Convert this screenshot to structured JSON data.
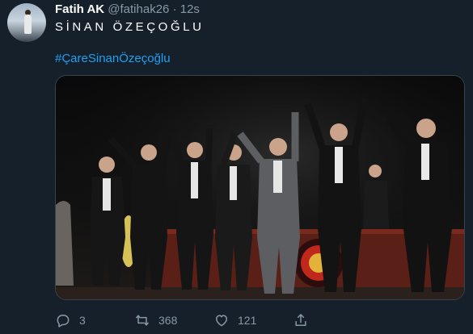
{
  "tweet": {
    "author_name": "Fatih AK",
    "author_handle": "@fatihak26",
    "separator": "·",
    "timestamp": "12s",
    "text": "SİNAN ÖZEÇOĞLU",
    "hashtag": "#ÇareSinanÖzeçoğlu"
  },
  "actions": {
    "reply_count": "3",
    "retweet_count": "368",
    "like_count": "121"
  },
  "icons": {
    "reply": "reply-icon",
    "retweet": "retweet-icon",
    "like": "like-icon",
    "share": "share-icon"
  },
  "colors": {
    "background": "#15202b",
    "muted": "#8899a6",
    "link": "#1da1f2"
  }
}
